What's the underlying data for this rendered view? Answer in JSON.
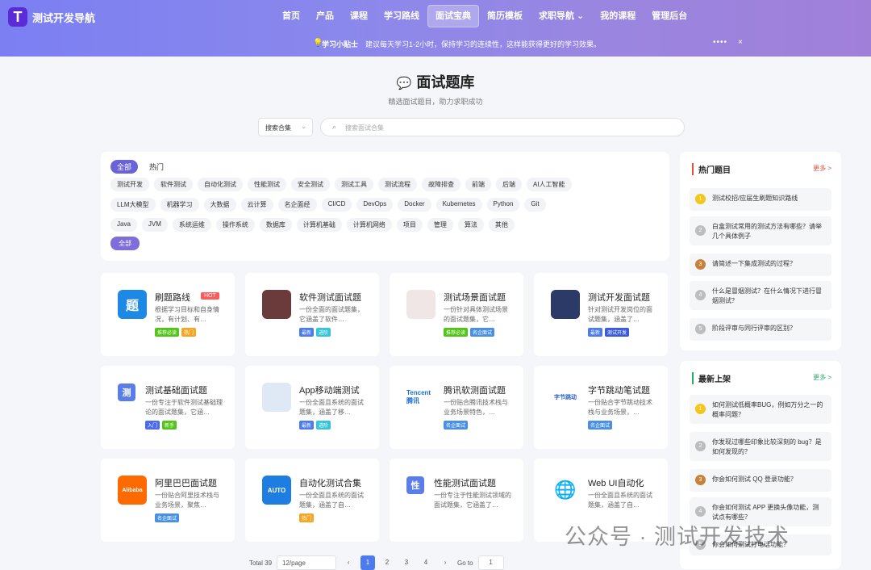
{
  "brand": {
    "mark": "T",
    "name": "测试开发导航"
  },
  "nav": [
    "首页",
    "产品",
    "课程",
    "学习路线",
    "面试宝典",
    "简历模板",
    "求职导航 ⌄",
    "我的课程",
    "管理后台"
  ],
  "nav_active": 4,
  "tip": {
    "title": "学习小贴士",
    "text": "建议每天学习1-2小时，保持学习的连续性，这样能获得更好的学习效果。",
    "dots": "••••",
    "close": "×"
  },
  "page": {
    "title": "面试题库",
    "subtitle": "精选面试题目，助力求职成功"
  },
  "search": {
    "select": "搜索合集",
    "placeholder": "搜索面试合集"
  },
  "filter": {
    "tabs": [
      "全部",
      "热门"
    ],
    "row1": [
      "测试开发",
      "软件测试",
      "自动化测试",
      "性能测试",
      "安全测试",
      "测试工具",
      "测试流程",
      "故障排查",
      "前端",
      "后端",
      "AI人工智能"
    ],
    "row2": [
      "LLM大模型",
      "机器学习",
      "大数据",
      "云计算",
      "名企面经",
      "CI/CD",
      "DevOps",
      "Docker",
      "Kubernetes",
      "Python",
      "Git"
    ],
    "row3": [
      "Java",
      "JVM",
      "系统运维",
      "操作系统",
      "数据库",
      "计算机基础",
      "计算机网络",
      "项目",
      "管理",
      "算法",
      "其他"
    ],
    "all_chip": "全部"
  },
  "cards": [
    {
      "title": "刷题路线",
      "desc": "根据学习目标和自身情况，有计划、有…",
      "badges": [
        "推荐必读",
        "热门"
      ],
      "hot": "HOT",
      "thumb": "题"
    },
    {
      "title": "软件测试面试题",
      "desc": "一份全面的面试题集，它涵盖了软件…",
      "badges": [
        "最新",
        "进阶"
      ]
    },
    {
      "title": "测试场景面试题",
      "desc": "一份针对具体测试场景的面试题集，它…",
      "badges": [
        "推荐必读",
        "名企面试"
      ]
    },
    {
      "title": "测试开发面试题",
      "desc": "针对测试开发岗位的面试题集，涵盖了…",
      "badges": [
        "最新",
        "测试开发"
      ]
    },
    {
      "title": "测试基础面试题",
      "desc": "一份专注于软件测试基础理论的面试题集，它涵…",
      "badges": [
        "入门",
        "新手"
      ],
      "thumb": "测"
    },
    {
      "title": "App移动端测试",
      "desc": "一份全面且系统的面试题集，涵盖了移…",
      "badges": [
        "最新",
        "进阶"
      ]
    },
    {
      "title": "腾讯软测面试题",
      "desc": "一份贴合腾讯技术栈与业务场景特色，…",
      "badges": [
        "名企面试"
      ],
      "thumb": "Tencent 腾讯"
    },
    {
      "title": "字节跳动笔试题",
      "desc": "一份贴合字节跳动技术栈与业务场景，…",
      "badges": [
        "名企面试"
      ],
      "thumb": "字节跳动"
    },
    {
      "title": "阿里巴巴面试题",
      "desc": "一份贴合阿里技术栈与业务场景，聚焦…",
      "badges": [
        "名企面试"
      ],
      "thumb": "Alibaba"
    },
    {
      "title": "自动化测试合集",
      "desc": "一份全面且系统的面试题集，涵盖了自…",
      "badges": [
        "热门"
      ],
      "thumb": "AUTO"
    },
    {
      "title": "性能测试面试题",
      "desc": "一份专注于性能测试领域的面试题集，它涵盖了…",
      "badges": [],
      "thumb": "性"
    },
    {
      "title": "Web UI自动化",
      "desc": "一份全面且系统的面试题集，涵盖了自…",
      "badges": []
    }
  ],
  "badge_colors": {
    "推荐必读": "#52c41a",
    "热门": "#f5a623",
    "最新": "#4b7bec",
    "进阶": "#36c5d8",
    "名企面试": "#4a90e2",
    "测试开发": "#3b5bdb",
    "入门": "#4b6bec",
    "新手": "#52c41a"
  },
  "hot_questions": {
    "title": "热门题目",
    "more": "更多 >",
    "items": [
      {
        "num": "1",
        "text": "测试校招/应届生刷题知识路线"
      },
      {
        "num": "2",
        "text": "白盒测试常用的测试方法有哪些？请举几个具体例子"
      },
      {
        "num": "3",
        "text": "请简述一下集成测试的过程？"
      },
      {
        "num": "4",
        "text": "什么是冒烟测试？在什么情况下进行冒烟测试？"
      },
      {
        "num": "5",
        "text": "阶段评审与同行评审的区别？"
      }
    ]
  },
  "new_questions": {
    "title": "最新上架",
    "more": "更多 >",
    "items": [
      {
        "num": "1",
        "text": "如何测试低概率BUG，例如万分之一的概率问题？"
      },
      {
        "num": "2",
        "text": "你发现过哪些印象比较深刻的 bug？是如何发现的？"
      },
      {
        "num": "3",
        "text": "你会如何测试 QQ 登录功能？"
      },
      {
        "num": "4",
        "text": "你会如何测试 APP 更换头像功能，测试点有哪些？"
      },
      {
        "num": "5",
        "text": "你会如何测试打电话功能？"
      }
    ]
  },
  "pagination": {
    "total": "Total 39",
    "page_size": "12/page",
    "prev": "‹",
    "pages": [
      "1",
      "2",
      "3",
      "4"
    ],
    "next": "›",
    "goto_label": "Go to",
    "goto_value": "1"
  },
  "watermark": "公众号 · 测试开发技术"
}
